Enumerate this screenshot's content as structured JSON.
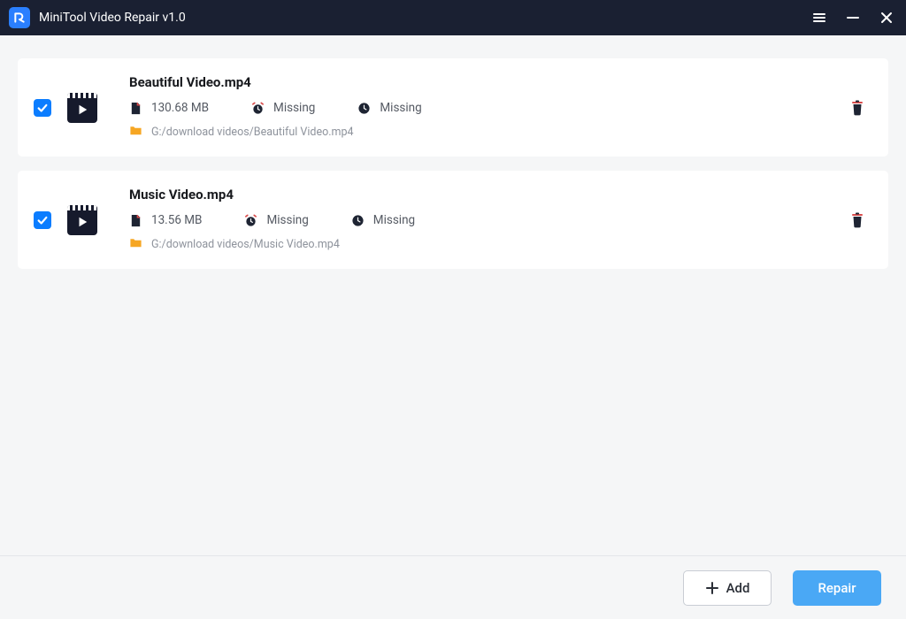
{
  "app": {
    "title": "MiniTool Video Repair v1.0"
  },
  "files": [
    {
      "name": "Beautiful Video.mp4",
      "size": "130.68 MB",
      "duration": "Missing",
      "created": "Missing",
      "path": "G:/download videos/Beautiful Video.mp4",
      "checked": true
    },
    {
      "name": "Music Video.mp4",
      "size": "13.56 MB",
      "duration": "Missing",
      "created": "Missing",
      "path": "G:/download videos/Music Video.mp4",
      "checked": true
    }
  ],
  "footer": {
    "add_label": "Add",
    "repair_label": "Repair"
  }
}
